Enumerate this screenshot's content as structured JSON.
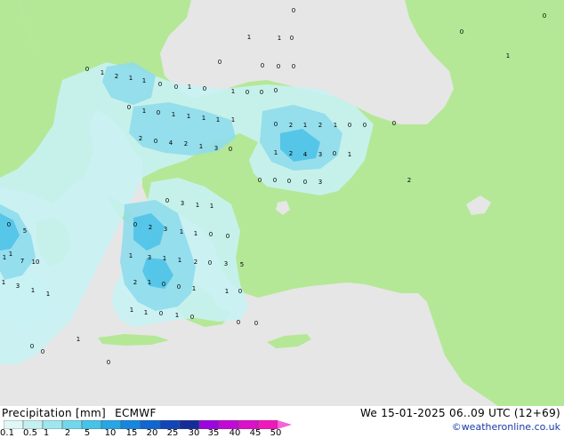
{
  "legend": {
    "title": "Precipitation [mm]",
    "model": "ECMWF",
    "valid_time": "We 15-01-2025 06..09 UTC (12+69)",
    "credit": "©weatheronline.co.uk",
    "ticks": [
      "0.1",
      "0.5",
      "1",
      "2",
      "5",
      "10",
      "15",
      "20",
      "25",
      "30",
      "35",
      "40",
      "45",
      "50"
    ],
    "colors": [
      "#e0f7f7",
      "#c4f0f2",
      "#a0e6ee",
      "#72d7ea",
      "#46c3e6",
      "#26a6e4",
      "#1686de",
      "#1166d2",
      "#1246b8",
      "#152c98",
      "#9b06e0",
      "#c20ad6",
      "#db10c8",
      "#f018bc",
      "#f464d8"
    ]
  },
  "map": {
    "colors": {
      "sea": "#e6e6e6",
      "land": "#b4e896",
      "precip_light": "#c8f2f4",
      "precip_mid": "#8fdcec",
      "precip_heavy": "#4fc3e8"
    }
  },
  "precip_values": [
    "0",
    "1",
    "1",
    "0",
    "0",
    "1",
    "0",
    "0",
    "1",
    "2",
    "1",
    "1",
    "0",
    "0",
    "1",
    "0",
    "1",
    "0",
    "0",
    "0",
    "0",
    "0",
    "0",
    "0",
    "0",
    "1",
    "0",
    "1",
    "1",
    "1",
    "1",
    "1",
    "2",
    "0",
    "4",
    "2",
    "1",
    "3",
    "0",
    "0",
    "2",
    "1",
    "2",
    "1",
    "0",
    "0",
    "0",
    "1",
    "2",
    "4",
    "3",
    "0",
    "1",
    "0",
    "0",
    "0",
    "0",
    "3",
    "2",
    "0",
    "3",
    "1",
    "1",
    "0",
    "2",
    "3",
    "1",
    "1",
    "0",
    "0",
    "0",
    "5",
    "1",
    "1",
    "7",
    "10",
    "1",
    "3",
    "1",
    "1",
    "1",
    "3",
    "1",
    "1",
    "2",
    "0",
    "3",
    "5",
    "2",
    "1",
    "0",
    "0",
    "1",
    "1",
    "1",
    "0",
    "1",
    "0",
    "0",
    "0",
    "0",
    "1",
    "0",
    "0",
    "1",
    "0"
  ]
}
